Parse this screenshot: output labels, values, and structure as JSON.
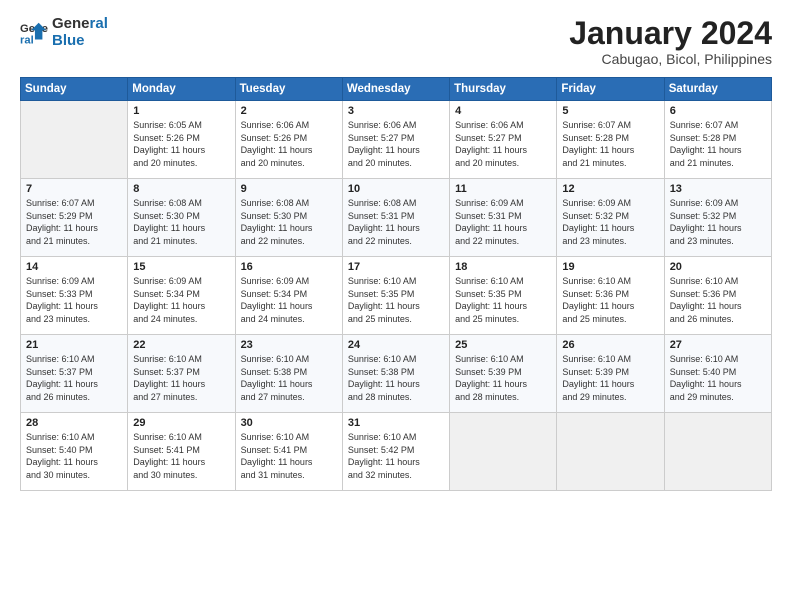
{
  "header": {
    "logo_line1": "General",
    "logo_line2": "Blue",
    "month": "January 2024",
    "location": "Cabugao, Bicol, Philippines"
  },
  "weekdays": [
    "Sunday",
    "Monday",
    "Tuesday",
    "Wednesday",
    "Thursday",
    "Friday",
    "Saturday"
  ],
  "weeks": [
    [
      {
        "day": "",
        "info": ""
      },
      {
        "day": "1",
        "info": "Sunrise: 6:05 AM\nSunset: 5:26 PM\nDaylight: 11 hours\nand 20 minutes."
      },
      {
        "day": "2",
        "info": "Sunrise: 6:06 AM\nSunset: 5:26 PM\nDaylight: 11 hours\nand 20 minutes."
      },
      {
        "day": "3",
        "info": "Sunrise: 6:06 AM\nSunset: 5:27 PM\nDaylight: 11 hours\nand 20 minutes."
      },
      {
        "day": "4",
        "info": "Sunrise: 6:06 AM\nSunset: 5:27 PM\nDaylight: 11 hours\nand 20 minutes."
      },
      {
        "day": "5",
        "info": "Sunrise: 6:07 AM\nSunset: 5:28 PM\nDaylight: 11 hours\nand 21 minutes."
      },
      {
        "day": "6",
        "info": "Sunrise: 6:07 AM\nSunset: 5:28 PM\nDaylight: 11 hours\nand 21 minutes."
      }
    ],
    [
      {
        "day": "7",
        "info": "Sunrise: 6:07 AM\nSunset: 5:29 PM\nDaylight: 11 hours\nand 21 minutes."
      },
      {
        "day": "8",
        "info": "Sunrise: 6:08 AM\nSunset: 5:30 PM\nDaylight: 11 hours\nand 21 minutes."
      },
      {
        "day": "9",
        "info": "Sunrise: 6:08 AM\nSunset: 5:30 PM\nDaylight: 11 hours\nand 22 minutes."
      },
      {
        "day": "10",
        "info": "Sunrise: 6:08 AM\nSunset: 5:31 PM\nDaylight: 11 hours\nand 22 minutes."
      },
      {
        "day": "11",
        "info": "Sunrise: 6:09 AM\nSunset: 5:31 PM\nDaylight: 11 hours\nand 22 minutes."
      },
      {
        "day": "12",
        "info": "Sunrise: 6:09 AM\nSunset: 5:32 PM\nDaylight: 11 hours\nand 23 minutes."
      },
      {
        "day": "13",
        "info": "Sunrise: 6:09 AM\nSunset: 5:32 PM\nDaylight: 11 hours\nand 23 minutes."
      }
    ],
    [
      {
        "day": "14",
        "info": "Sunrise: 6:09 AM\nSunset: 5:33 PM\nDaylight: 11 hours\nand 23 minutes."
      },
      {
        "day": "15",
        "info": "Sunrise: 6:09 AM\nSunset: 5:34 PM\nDaylight: 11 hours\nand 24 minutes."
      },
      {
        "day": "16",
        "info": "Sunrise: 6:09 AM\nSunset: 5:34 PM\nDaylight: 11 hours\nand 24 minutes."
      },
      {
        "day": "17",
        "info": "Sunrise: 6:10 AM\nSunset: 5:35 PM\nDaylight: 11 hours\nand 25 minutes."
      },
      {
        "day": "18",
        "info": "Sunrise: 6:10 AM\nSunset: 5:35 PM\nDaylight: 11 hours\nand 25 minutes."
      },
      {
        "day": "19",
        "info": "Sunrise: 6:10 AM\nSunset: 5:36 PM\nDaylight: 11 hours\nand 25 minutes."
      },
      {
        "day": "20",
        "info": "Sunrise: 6:10 AM\nSunset: 5:36 PM\nDaylight: 11 hours\nand 26 minutes."
      }
    ],
    [
      {
        "day": "21",
        "info": "Sunrise: 6:10 AM\nSunset: 5:37 PM\nDaylight: 11 hours\nand 26 minutes."
      },
      {
        "day": "22",
        "info": "Sunrise: 6:10 AM\nSunset: 5:37 PM\nDaylight: 11 hours\nand 27 minutes."
      },
      {
        "day": "23",
        "info": "Sunrise: 6:10 AM\nSunset: 5:38 PM\nDaylight: 11 hours\nand 27 minutes."
      },
      {
        "day": "24",
        "info": "Sunrise: 6:10 AM\nSunset: 5:38 PM\nDaylight: 11 hours\nand 28 minutes."
      },
      {
        "day": "25",
        "info": "Sunrise: 6:10 AM\nSunset: 5:39 PM\nDaylight: 11 hours\nand 28 minutes."
      },
      {
        "day": "26",
        "info": "Sunrise: 6:10 AM\nSunset: 5:39 PM\nDaylight: 11 hours\nand 29 minutes."
      },
      {
        "day": "27",
        "info": "Sunrise: 6:10 AM\nSunset: 5:40 PM\nDaylight: 11 hours\nand 29 minutes."
      }
    ],
    [
      {
        "day": "28",
        "info": "Sunrise: 6:10 AM\nSunset: 5:40 PM\nDaylight: 11 hours\nand 30 minutes."
      },
      {
        "day": "29",
        "info": "Sunrise: 6:10 AM\nSunset: 5:41 PM\nDaylight: 11 hours\nand 30 minutes."
      },
      {
        "day": "30",
        "info": "Sunrise: 6:10 AM\nSunset: 5:41 PM\nDaylight: 11 hours\nand 31 minutes."
      },
      {
        "day": "31",
        "info": "Sunrise: 6:10 AM\nSunset: 5:42 PM\nDaylight: 11 hours\nand 32 minutes."
      },
      {
        "day": "",
        "info": ""
      },
      {
        "day": "",
        "info": ""
      },
      {
        "day": "",
        "info": ""
      }
    ]
  ]
}
